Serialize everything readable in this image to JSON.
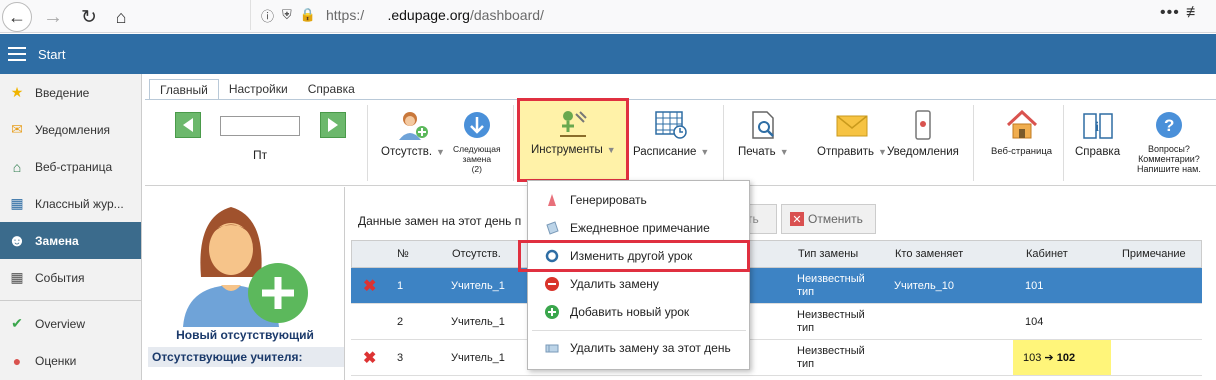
{
  "browser": {
    "url_prefix": "https:/",
    "url_domain": ".edupage.org",
    "url_path": "/dashboard/",
    "menu_dots": "•••"
  },
  "header": {
    "title": "Start"
  },
  "sidebar": {
    "items": [
      {
        "label": "Введение",
        "icon": "star-icon"
      },
      {
        "label": "Уведомления",
        "icon": "envelope-icon"
      },
      {
        "label": "Веб-страница",
        "icon": "house-icon"
      },
      {
        "label": "Классный жур...",
        "icon": "book-icon"
      },
      {
        "label": "Замена",
        "icon": "person-icon"
      },
      {
        "label": "События",
        "icon": "calendar-icon"
      },
      {
        "label": "Overview",
        "icon": "check-circle-icon"
      },
      {
        "label": "Оценки",
        "icon": "grade-icon"
      }
    ]
  },
  "tabs": [
    "Главный",
    "Настройки",
    "Справка"
  ],
  "ribbon": {
    "day": "Пт",
    "absences": "Отсутств.",
    "next_sub_1": "Следующая",
    "next_sub_2": "замена",
    "next_sub_3": "(2)",
    "tools": "Инструменты",
    "schedule": "Расписание",
    "print": "Печать",
    "send": "Отправить",
    "notifications": "Уведомления",
    "web_page": "Веб-страница",
    "help": "Справка",
    "questions_1": "Вопросы?",
    "questions_2": "Комментарии?",
    "questions_3": "Напишите нам."
  },
  "content": {
    "new_absent": "Новый отсутствующий",
    "absent_teachers": "Отсутствующие учителя:",
    "data_label": "Данные замен на этот день п",
    "partial_btn": "ть",
    "cancel_btn": "Отменить"
  },
  "grid": {
    "headers": {
      "num": "№",
      "absent": "Отсутств.",
      "type": "Тип замены",
      "who": "Кто заменяет",
      "room": "Кабинет",
      "note": "Примечание"
    },
    "rows": [
      {
        "num": "1",
        "absent": "Учитель_1",
        "type_1": "Неизвестный",
        "type_2": "тип",
        "who": "Учитель_10",
        "room": "101"
      },
      {
        "num": "2",
        "absent": "Учитель_1",
        "type_1": "Неизвестный",
        "type_2": "тип",
        "who": "",
        "room": "104"
      },
      {
        "num": "3",
        "absent": "Учитель_1",
        "type_1": "Неизвестный",
        "type_2": "тип",
        "who": "",
        "room_from": "103",
        "room_arrow": "➔",
        "room_to": "102"
      }
    ]
  },
  "dropdown": {
    "generate": "Генерировать",
    "daily_note": "Ежедневное примечание",
    "change_other": "Изменить другой урок",
    "delete_sub": "Удалить замену",
    "add_lesson": "Добавить новый урок",
    "delete_day": "Удалить замену за этот день"
  },
  "colors": {
    "header_blue": "#2e6da4",
    "selected_row": "#3d83c4",
    "highlight_red": "#e03040",
    "room_yellow": "#fff57a"
  }
}
